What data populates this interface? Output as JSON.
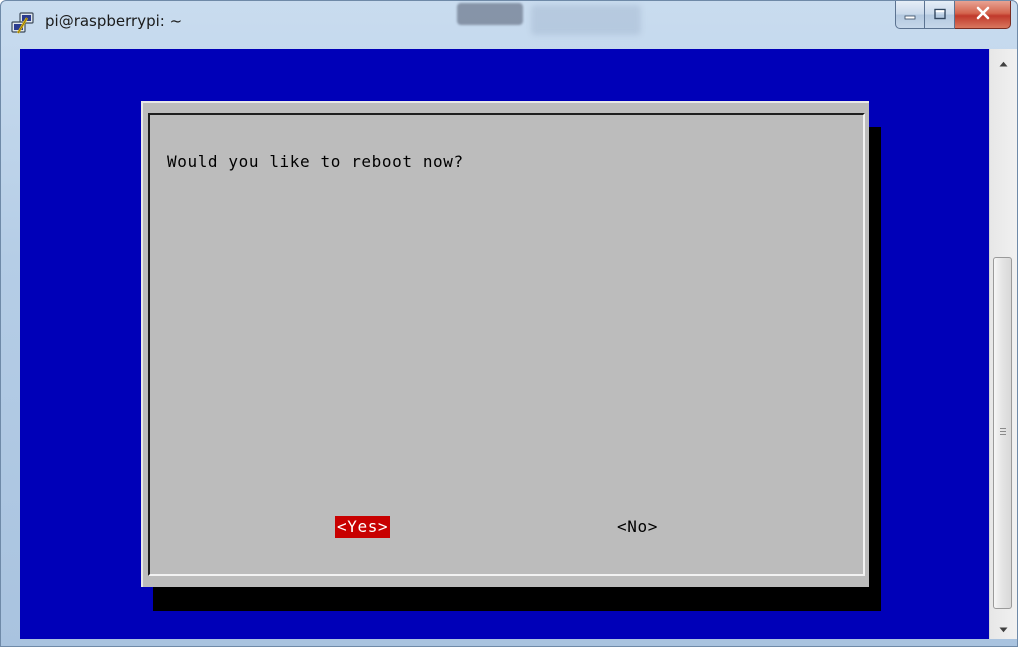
{
  "window": {
    "title": "pi@raspberrypi: ~",
    "icons": {
      "app": "putty-icon",
      "minimize": "minimize-icon",
      "maximize": "maximize-icon",
      "close": "close-icon"
    }
  },
  "dialog": {
    "prompt": "Would you like to reboot now?",
    "buttons": {
      "yes": "<Yes>",
      "no": "<No>"
    },
    "selected_button": "yes"
  },
  "scrollbar": {
    "up_icon": "scroll-up-arrow-icon",
    "down_icon": "scroll-down-arrow-icon"
  },
  "colors": {
    "terminal_background": "#0000b8",
    "dialog_background": "#bcbcbc",
    "selected_button_background": "#c80000",
    "selected_button_text": "#ffffff",
    "dialog_shadow": "#000000"
  }
}
